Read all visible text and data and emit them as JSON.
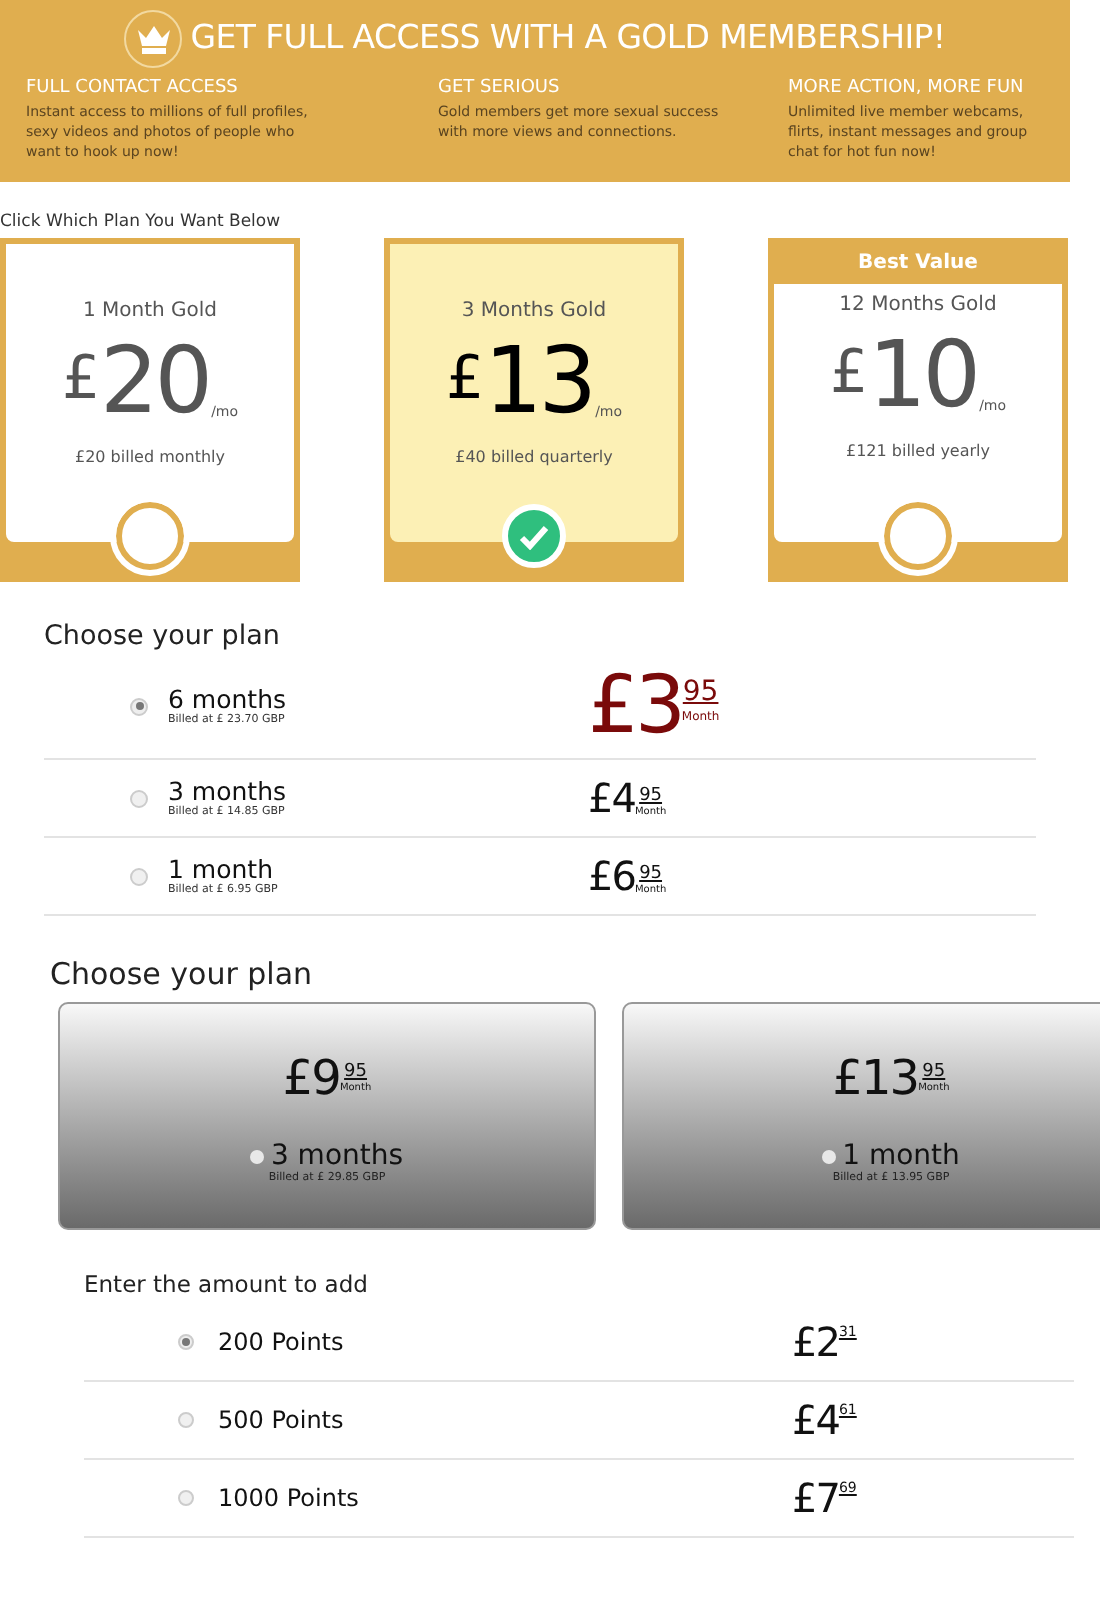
{
  "banner": {
    "title": "GET FULL ACCESS WITH A GOLD MEMBERSHIP!",
    "features": [
      {
        "heading": "FULL CONTACT ACCESS",
        "text": "Instant access to millions of full profiles, sexy videos and photos of people who want to hook up now!"
      },
      {
        "heading": "GET SERIOUS",
        "text": "Gold members get more sexual success with more views and connections."
      },
      {
        "heading": "MORE ACTION, MORE FUN",
        "text": "Unlimited live member webcams, flirts, instant messages and group chat for hot fun now!"
      }
    ]
  },
  "plan_prompt": "Click Which Plan You Want Below",
  "gold_plans": [
    {
      "name": "1 Month Gold",
      "symbol": "£",
      "amount": "20",
      "unit": "/mo",
      "billing": "£20 billed monthly",
      "selected": false
    },
    {
      "name": "3 Months Gold",
      "symbol": "£",
      "amount": "13",
      "unit": "/mo",
      "billing": "£40 billed quarterly",
      "selected": true
    },
    {
      "badge": "Best Value",
      "name": "12 Months Gold",
      "symbol": "£",
      "amount": "10",
      "unit": "/mo",
      "billing": "£121 billed yearly",
      "selected": false
    }
  ],
  "list_plans": {
    "heading": "Choose your plan",
    "options": [
      {
        "label": "6 months",
        "billing": "Billed at £ 23.70 GBP",
        "price_whole": "£3",
        "price_cents": "95",
        "per": "Month",
        "selected": true
      },
      {
        "label": "3 months",
        "billing": "Billed at £ 14.85 GBP",
        "price_whole": "£4",
        "price_cents": "95",
        "per": "Month",
        "selected": false
      },
      {
        "label": "1 month",
        "billing": "Billed at £ 6.95 GBP",
        "price_whole": "£6",
        "price_cents": "95",
        "per": "Month",
        "selected": false
      }
    ]
  },
  "button_plans": {
    "heading": "Choose your plan",
    "options": [
      {
        "price_whole": "£9",
        "price_cents": "95",
        "per": "Month",
        "label": "3 months",
        "billing": "Billed at £ 29.85 GBP",
        "selected": false
      },
      {
        "price_whole": "£13",
        "price_cents": "95",
        "per": "Month",
        "label": "1 month",
        "billing": "Billed at £ 13.95 GBP",
        "selected": false
      }
    ]
  },
  "points": {
    "heading": "Enter the amount to add",
    "options": [
      {
        "label": "200 Points",
        "price_whole": "£2",
        "price_cents": "31",
        "selected": true
      },
      {
        "label": "500 Points",
        "price_whole": "£4",
        "price_cents": "61",
        "selected": false
      },
      {
        "label": "1000 Points",
        "price_whole": "£7",
        "price_cents": "69",
        "selected": false
      }
    ]
  }
}
